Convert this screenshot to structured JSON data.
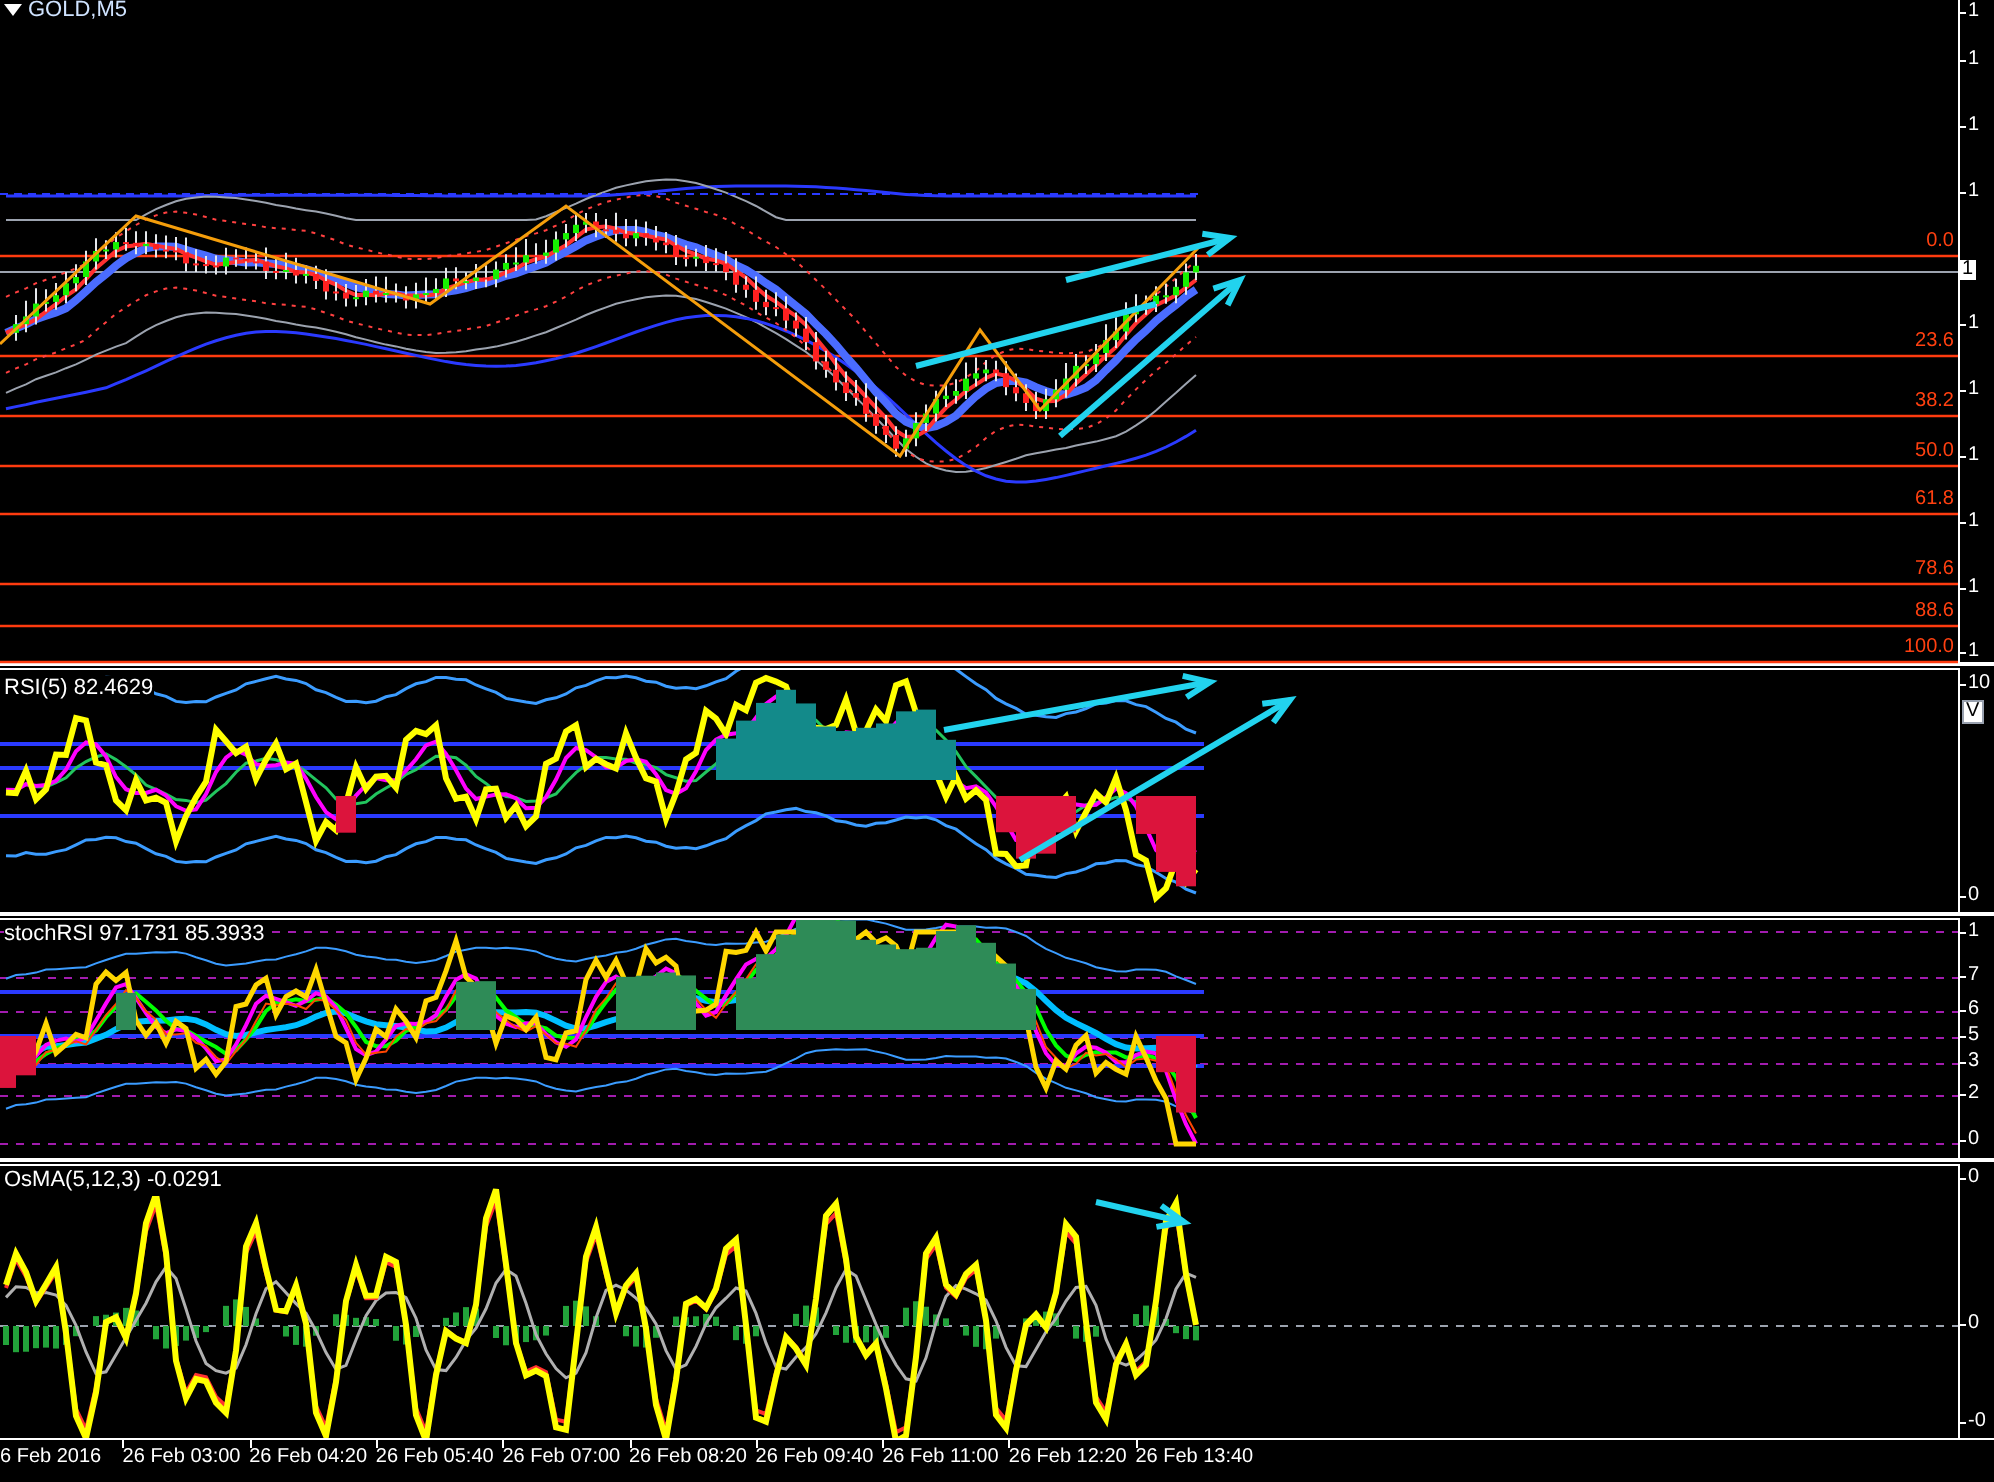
{
  "main_chart": {
    "symbol": "GOLD,M5",
    "fib_levels": [
      {
        "label": "0.0"
      },
      {
        "label": "23.6"
      },
      {
        "label": "38.2"
      },
      {
        "label": "50.0"
      },
      {
        "label": "61.8"
      },
      {
        "label": "78.6"
      },
      {
        "label": "88.6"
      },
      {
        "label": "100.0"
      }
    ],
    "price_axis": [
      "1",
      "1",
      "1",
      "1",
      "1",
      "1",
      "1",
      "1",
      "1",
      "1"
    ],
    "current_price": "1"
  },
  "rsi_panel": {
    "title": "RSI(5) 82.4629",
    "axis": [
      "10",
      "0"
    ],
    "current_value": "V"
  },
  "stoch_rsi_panel": {
    "title": "stochRSI 97.1731 85.3933",
    "axis": [
      "1",
      "7",
      "6",
      "5",
      "3",
      "2",
      "0"
    ]
  },
  "osma_panel": {
    "title": "OsMA(5,12,3) -0.0291",
    "axis": [
      "0",
      "0",
      "-0"
    ]
  },
  "time_axis": [
    "6 Feb 2016",
    "26 Feb 03:00",
    "26 Feb 04:20",
    "26 Feb 05:40",
    "26 Feb 07:00",
    "26 Feb 08:20",
    "26 Feb 09:40",
    "26 Feb 11:00",
    "26 Feb 12:20",
    "26 Feb 13:40"
  ]
}
